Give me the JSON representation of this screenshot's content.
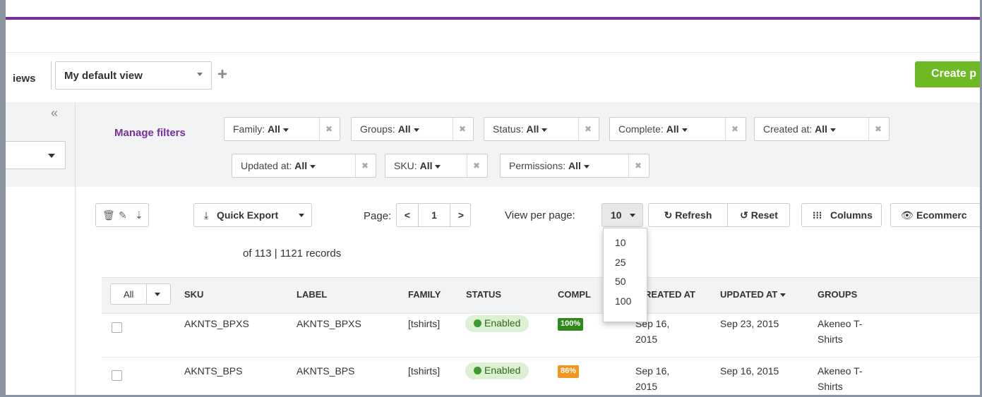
{
  "views": {
    "label": "iews",
    "current": "My default view",
    "add_icon": "plus-icon"
  },
  "create_button": "Create p",
  "filters": {
    "manage": "Manage filters",
    "items": [
      {
        "name": "Family:",
        "value": "All"
      },
      {
        "name": "Groups:",
        "value": "All"
      },
      {
        "name": "Status:",
        "value": "All"
      },
      {
        "name": "Complete:",
        "value": "All"
      },
      {
        "name": "Created at:",
        "value": "All"
      },
      {
        "name": "Updated at:",
        "value": "All"
      },
      {
        "name": "SKU:",
        "value": "All"
      },
      {
        "name": "Permissions:",
        "value": "All"
      }
    ]
  },
  "toolbar": {
    "quick_export": "Quick Export",
    "page_label": "Page:",
    "page_value": "1",
    "records": "of 113 | 1121 records",
    "view_per_page_label": "View per page:",
    "view_per_page_value": "10",
    "refresh": "Refresh",
    "reset": "Reset",
    "columns": "Columns",
    "ecommerce": "Ecommerc",
    "per_page_options": [
      "10",
      "25",
      "50",
      "100"
    ]
  },
  "table": {
    "select_all": "All",
    "headers": {
      "sku": "SKU",
      "label": "LABEL",
      "family": "FAMILY",
      "status": "STATUS",
      "complete": "COMPL",
      "created": "REATED AT",
      "updated": "UPDATED AT",
      "groups": "GROUPS"
    },
    "rows": [
      {
        "sku": "AKNTS_BPXS",
        "label": "AKNTS_BPXS",
        "family": "[tshirts]",
        "status": "Enabled",
        "complete": "100%",
        "created_1": "Sep 16,",
        "created_2": "2015",
        "updated": "Sep 23, 2015",
        "groups_1": "Akeneo T-",
        "groups_2": "Shirts"
      },
      {
        "sku": "AKNTS_BPS",
        "label": "AKNTS_BPS",
        "family": "[tshirts]",
        "status": "Enabled",
        "complete": "86%",
        "created_1": "Sep 16,",
        "created_2": "2015",
        "updated": "Sep 16, 2015",
        "groups_1": "Akeneo T-",
        "groups_2": "Shirts"
      }
    ]
  },
  "colors": {
    "brand_purple": "#7b2d9b",
    "create_green": "#6fb925",
    "complete_full": "#2e8a1a",
    "complete_partial": "#f0951e",
    "enabled_bg": "#dcf1d2"
  }
}
